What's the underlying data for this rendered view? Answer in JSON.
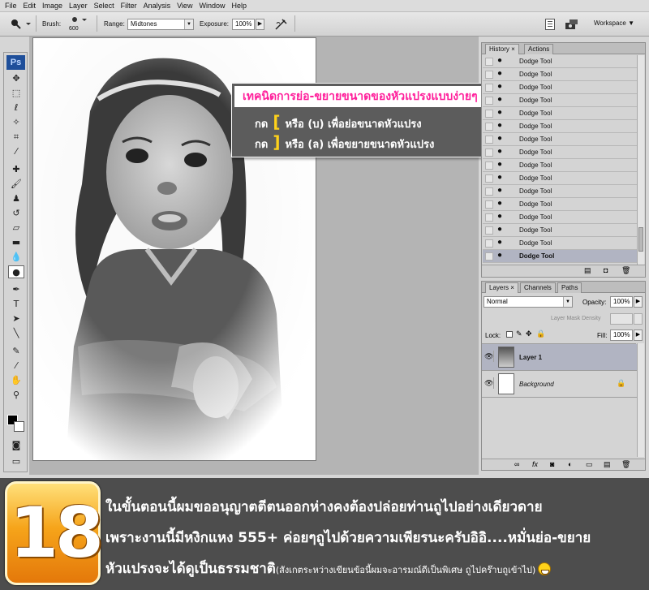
{
  "menu": [
    "File",
    "Edit",
    "Image",
    "Layer",
    "Select",
    "Filter",
    "Analysis",
    "View",
    "Window",
    "Help"
  ],
  "options": {
    "brush_label": "Brush:",
    "brush_size": "600",
    "range_label": "Range:",
    "range_value": "Midtones",
    "exposure_label": "Exposure:",
    "exposure_value": "100%",
    "workspace_label": "Workspace"
  },
  "toolbox": {
    "logo": "Ps"
  },
  "callout": {
    "title": "เทคนิดการย่อ-ขยายขนาดของหัวแปรงแบบง่ายๆ",
    "line1_prefix": "กด",
    "line1_key": "[",
    "line1_text": "หรือ (บ) เพื่อย่อขนาดหัวแปรง",
    "line2_prefix": "กด",
    "line2_key": "]",
    "line2_text": "หรือ (ล) เพื่อขยายขนาดหัวแปรง"
  },
  "history": {
    "tabs": [
      "History",
      "Actions"
    ],
    "items": [
      "Dodge Tool",
      "Dodge Tool",
      "Dodge Tool",
      "Dodge Tool",
      "Dodge Tool",
      "Dodge Tool",
      "Dodge Tool",
      "Dodge Tool",
      "Dodge Tool",
      "Dodge Tool",
      "Dodge Tool",
      "Dodge Tool",
      "Dodge Tool",
      "Dodge Tool",
      "Dodge Tool",
      "Dodge Tool"
    ]
  },
  "layers": {
    "tabs": [
      "Layers",
      "Channels",
      "Paths"
    ],
    "blend_mode": "Normal",
    "opacity_label": "Opacity:",
    "opacity_value": "100%",
    "mask_density_label": "Layer Mask Density",
    "lock_label": "Lock:",
    "fill_label": "Fill:",
    "fill_value": "100%",
    "items": [
      {
        "name": "Layer 1",
        "selected": true
      },
      {
        "name": "Background",
        "selected": false
      }
    ]
  },
  "banner": {
    "step_number": "18",
    "line1": "ในขั้นตอนนี้ผมขออนุญาตตีตนออกห่างคงต้องปล่อยท่านถูไปอย่างเดียวดาย",
    "line2": "เพราะงานนี้มีหงิกแหง 555+  ค่อยๆถูไปด้วยความเพียรนะครับอิอิ....หมั่นย่อ-ขยาย",
    "line3_main": "หัวแปรงจะได้ดูเป็นธรรมชาติ",
    "line3_small": "(สังเกตระหว่างเขียนข้อนี้ผมจะอารมณ์ดีเป็นพิเศษ ถูไปคร๊าบถูเข้าไป)"
  },
  "colors": {
    "accent": "#ff1f9b",
    "bracket": "#ffd21a",
    "banner_bg": "#4d4d4d",
    "badge": "#f6a41a"
  }
}
